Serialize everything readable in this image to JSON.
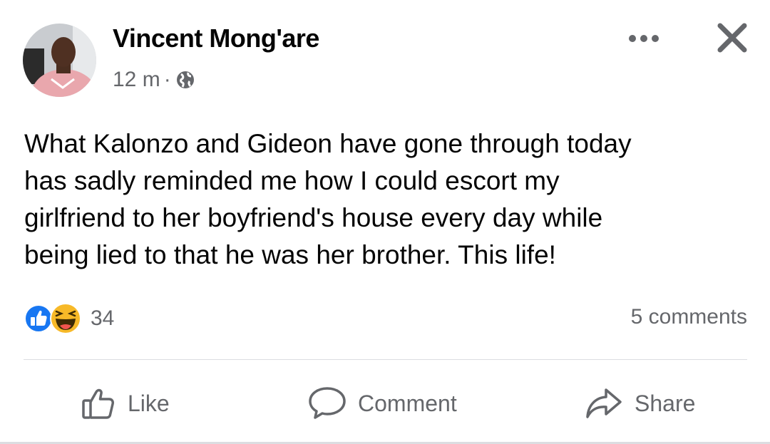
{
  "post": {
    "author": "Vincent Mong'are",
    "time": "12 m",
    "separator": "·",
    "privacy_icon": "globe-icon",
    "text_lines": [
      "What Kalonzo and Gideon have gone through today",
      "has sadly reminded me how I could escort my",
      "girlfriend to her boyfriend's house every day while",
      "being lied to that he was her brother. This life!"
    ],
    "reactions": {
      "icons": [
        "like-reaction-icon",
        "haha-reaction-icon"
      ],
      "count": "34"
    },
    "comments": "5 comments"
  },
  "header_actions": {
    "more_icon": "more-options-icon",
    "close_icon": "close-icon"
  },
  "actions": {
    "like": "Like",
    "comment": "Comment",
    "share": "Share"
  },
  "colors": {
    "text": "#050505",
    "secondary": "#65676b",
    "like_blue": "#1877f2",
    "haha_yellow": "#f7b928",
    "divider": "#dcdde1"
  }
}
